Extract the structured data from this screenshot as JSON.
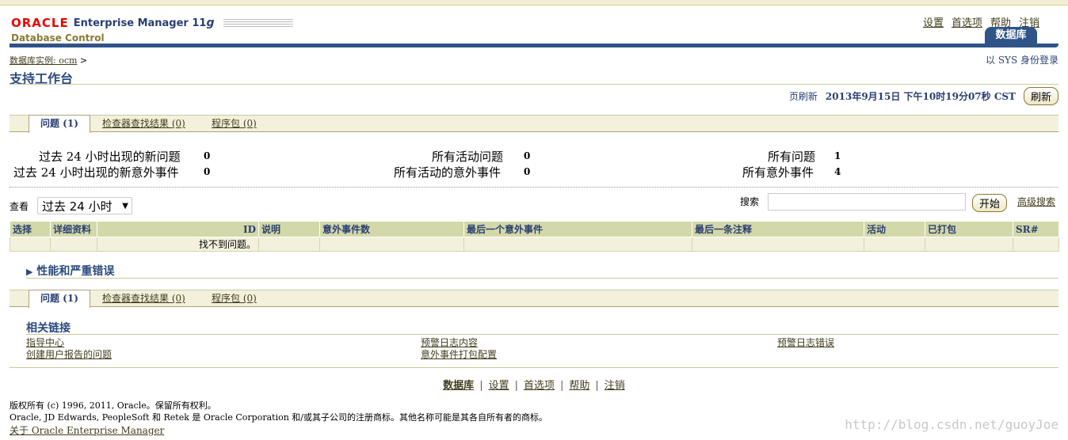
{
  "brand": {
    "oracle": "ORACLE",
    "product": "Enterprise Manager 11",
    "product_version_suffix": "g",
    "subtitle": "Database Control"
  },
  "top_links": [
    "设置",
    "首选项",
    "帮助",
    "注销"
  ],
  "main_tab": "数据库",
  "breadcrumb": {
    "link": "数据库实例: ocm",
    "sep": ">"
  },
  "login_status": "以 SYS 身份登录",
  "page_title": "支持工作台",
  "refresh": {
    "label": "页刷新",
    "timestamp": "2013年9月15日  下午10时19分07秒  CST",
    "button": "刷新"
  },
  "subtabs": [
    {
      "label": "问题  (1)",
      "active": true
    },
    {
      "label": "检查器查找结果  (0)",
      "active": false
    },
    {
      "label": "程序包  (0)",
      "active": false
    }
  ],
  "stats": {
    "new_problems_24h": {
      "label": "过去  24 小时出现的新问题",
      "value": "0"
    },
    "new_incidents_24h": {
      "label": "过去  24 小时出现的新意外事件",
      "value": "0"
    },
    "active_problems": {
      "label": "所有活动问题",
      "value": "0"
    },
    "active_incidents": {
      "label": "所有活动的意外事件",
      "value": "0"
    },
    "all_problems": {
      "label": "所有问题",
      "value": "1"
    },
    "all_incidents": {
      "label": "所有意外事件",
      "value": "4"
    }
  },
  "view": {
    "label": "查看",
    "selected": "过去  24 小时"
  },
  "search": {
    "label": "搜索",
    "value": "",
    "button": "开始",
    "advanced": "高级搜索"
  },
  "table": {
    "columns": [
      "选择",
      "详细资料",
      "ID",
      "说明",
      "意外事件数",
      "最后一个意外事件",
      "最后一条注释",
      "活动",
      "已打包",
      "SR#"
    ],
    "empty_message": "找不到问题。"
  },
  "perf_section": "性能和严重错误",
  "related": {
    "title": "相关链接",
    "links": [
      "指导中心",
      "创建用户报告的问题",
      "预警日志内容",
      "意外事件打包配置",
      "预警日志错误"
    ]
  },
  "footer_nav": [
    "数据库",
    "设置",
    "首选项",
    "帮助",
    "注销"
  ],
  "copyright": "版权所有  (c) 1996, 2011, Oracle。保留所有权利。",
  "trademark": "Oracle, JD Edwards, PeopleSoft 和  Retek 是  Oracle Corporation 和/或其子公司的注册商标。其他名称可能是其各自所有者的商标。",
  "about_link": "关于  Oracle Enterprise Manager",
  "watermark": "http://blog.csdn.net/guoyJoe"
}
